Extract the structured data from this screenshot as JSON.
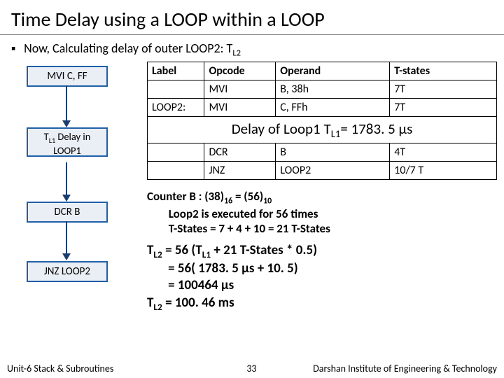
{
  "title": "Time Delay using a LOOP within a LOOP",
  "bullet_sym": "▪",
  "intro_a": "Now, Calculating delay of outer LOOP2: T",
  "intro_sub": "L2",
  "flow": {
    "b1": "MVI C, FF",
    "b2a": "T",
    "b2sub": "L1",
    "b2b": " Delay in",
    "b2c": "LOOP1",
    "b3": "DCR B",
    "b4": "JNZ LOOP2"
  },
  "table": {
    "headers": {
      "label": "Label",
      "opcode": "Opcode",
      "operand": "Operand",
      "tstates": "T-states"
    },
    "rows": [
      {
        "label": "",
        "opcode": "MVI",
        "operand": "B, 38h",
        "tstates": "7T"
      },
      {
        "label": "LOOP2:",
        "opcode": "MVI",
        "operand": "C, FFh",
        "tstates": "7T"
      }
    ],
    "banner_a": "Delay of Loop1 T",
    "banner_sub": "L1",
    "banner_b": "= 1783. 5 μs",
    "rows2": [
      {
        "label": "",
        "opcode": "DCR",
        "operand": "B",
        "tstates": "4T"
      },
      {
        "label": "",
        "opcode": "JNZ",
        "operand": "LOOP2",
        "tstates": "10/7 T"
      }
    ]
  },
  "notes": {
    "l1a": "Counter B : (38)",
    "l1s1": "16",
    "l1b": " = (56)",
    "l1s2": "10",
    "l2": "Loop2 is executed for 56 times",
    "l3": "T-States = 7 + 4 + 10 = 21 T-States"
  },
  "calc": {
    "l1a": "T",
    "l1sub": "L2",
    "l1b": " = 56 (T",
    "l1sub2": "L1",
    "l1c": " + 21 T-States * 0.5)",
    "l2": "       = 56( 1783. 5 μs + 10. 5)",
    "l3": "       = 100464 μs",
    "l4a": "T",
    "l4sub": "L2",
    "l4b": " = 100. 46 ms"
  },
  "footer": {
    "unit": "Unit-6 Stack & Subroutines",
    "page": "33",
    "inst": "Darshan Institute of Engineering & Technology"
  }
}
